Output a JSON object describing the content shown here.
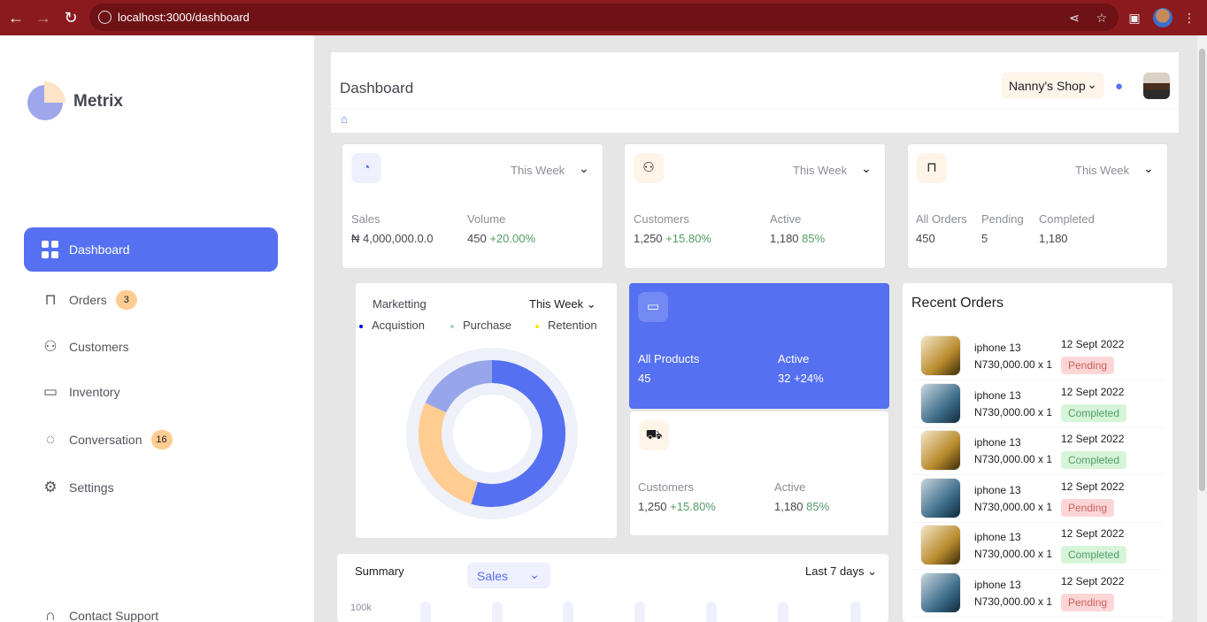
{
  "browser": {
    "url": "localhost:3000/dashboard"
  },
  "sidebar": {
    "brand": "Metrix",
    "items": [
      {
        "label": "Dashboard",
        "icon": "grid-icon",
        "active": true
      },
      {
        "label": "Orders",
        "icon": "bag-icon",
        "badge": "3"
      },
      {
        "label": "Customers",
        "icon": "users-icon"
      },
      {
        "label": "Inventory",
        "icon": "folder-icon"
      },
      {
        "label": "Conversation",
        "icon": "chat-icon",
        "badge": "16"
      },
      {
        "label": "Settings",
        "icon": "gear-icon"
      }
    ],
    "support": "Contact Support"
  },
  "header": {
    "title": "Dashboard",
    "shop": "Nanny's Shop"
  },
  "cards": {
    "sales": {
      "period": "This Week",
      "k1": "Sales",
      "v1": "₦ 4,000,000.0.0",
      "k2": "Volume",
      "v2": "450",
      "v2_delta": "+20.00%"
    },
    "customers": {
      "period": "This Week",
      "k1": "Customers",
      "v1": "1,250",
      "v1_delta": "+15.80%",
      "k2": "Active",
      "v2": "1,180",
      "v2_delta": "85%"
    },
    "orders": {
      "period": "This Week",
      "k1": "All Orders",
      "v1": "450",
      "k2": "Pending",
      "v2": "5",
      "k3": "Completed",
      "v3": "1,180"
    }
  },
  "marketing": {
    "title": "Marketting",
    "period": "This Week",
    "legend": [
      "Acquistion",
      "Purchase",
      "Retention"
    ],
    "colors": {
      "acquisition": "#5570f1",
      "purchase": "#97a5eb",
      "retention": "#ffcc91"
    }
  },
  "products": {
    "k1": "All Products",
    "v1": "45",
    "k2": "Active",
    "v2": "32",
    "v2_delta": "+24%"
  },
  "customers2": {
    "k1": "Customers",
    "v1": "1,250",
    "v1_delta": "+15.80%",
    "k2": "Active",
    "v2": "1,180",
    "v2_delta": "85%"
  },
  "recent": {
    "title": "Recent Orders",
    "orders": [
      {
        "name": "iphone 13",
        "price": "N730,000.00 x 1",
        "date": "12 Sept 2022",
        "status": "Pending",
        "color": "gold"
      },
      {
        "name": "iphone 13",
        "price": "N730,000.00 x 1",
        "date": "12 Sept 2022",
        "status": "Completed",
        "color": "blue"
      },
      {
        "name": "iphone 13",
        "price": "N730,000.00 x 1",
        "date": "12 Sept 2022",
        "status": "Completed",
        "color": "gold"
      },
      {
        "name": "iphone 13",
        "price": "N730,000.00 x 1",
        "date": "12 Sept 2022",
        "status": "Pending",
        "color": "blue"
      },
      {
        "name": "iphone 13",
        "price": "N730,000.00 x 1",
        "date": "12 Sept 2022",
        "status": "Completed",
        "color": "gold"
      },
      {
        "name": "iphone 13",
        "price": "N730,000.00 x 1",
        "date": "12 Sept 2022",
        "status": "Pending",
        "color": "blue"
      }
    ]
  },
  "summary": {
    "title": "Summary",
    "select": "Sales",
    "range": "Last 7 days",
    "ylabel": "100k"
  }
}
